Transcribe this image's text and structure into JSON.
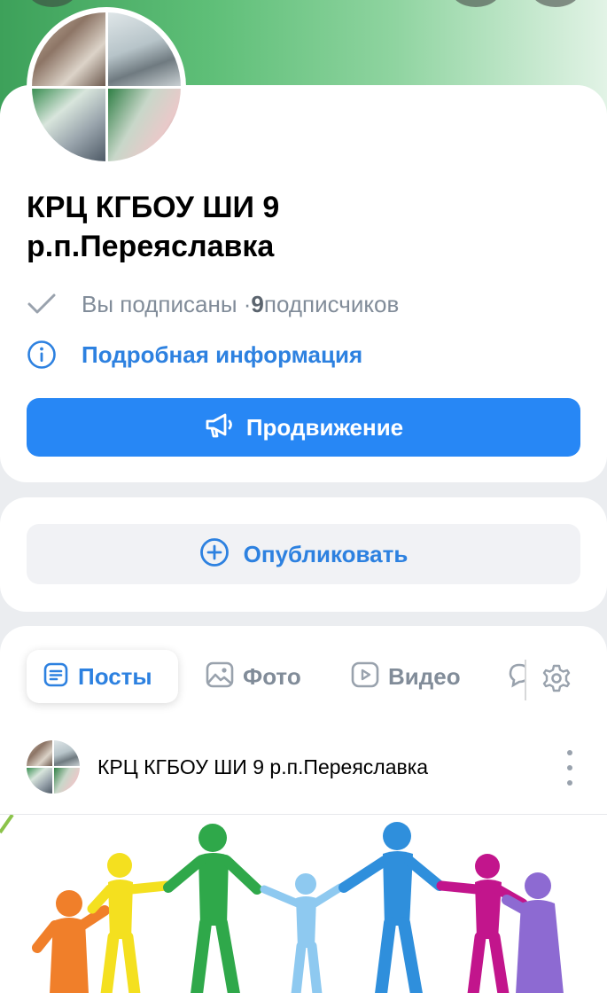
{
  "community": {
    "name": "КРЦ  КГБОУ ШИ 9\nр.п.Переяславка",
    "author_name": "КРЦ  КГБОУ ШИ 9 р.п.Переяславка"
  },
  "subscription": {
    "status": "Вы подписаны · ",
    "count": "9",
    "count_suffix": " подписчиков"
  },
  "info_link": "Подробная информация",
  "promote_button": "Продвижение",
  "publish_button": "Опубликовать",
  "tabs": [
    {
      "label": "Посты",
      "icon": "posts-icon",
      "active": true
    },
    {
      "label": "Фото",
      "icon": "photo-icon",
      "active": false
    },
    {
      "label": "Видео",
      "icon": "video-icon",
      "active": false
    }
  ],
  "icons": {
    "subscribed": "check-icon",
    "info": "info-icon",
    "promote": "megaphone-icon",
    "publish": "plus-circle-icon",
    "settings": "gear-icon",
    "post_menu": "more-vertical-icon"
  },
  "colors": {
    "accent": "#2787f5",
    "link": "#2d81e0",
    "secondary_text": "#818c99",
    "background": "#ebedf0"
  }
}
